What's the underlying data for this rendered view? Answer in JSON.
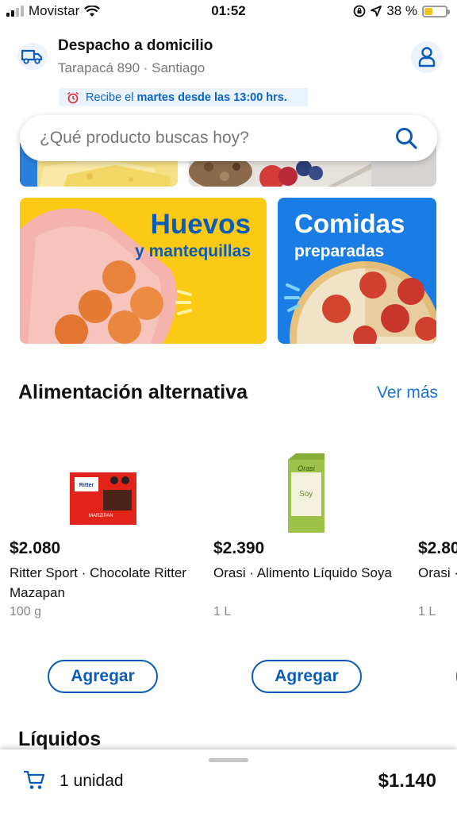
{
  "status_bar": {
    "carrier": "Movistar",
    "time": "01:52",
    "battery_percent": "38 %",
    "battery_level": 0.38
  },
  "header": {
    "delivery_title": "Despacho a domicilio",
    "delivery_address": "Tarapacá 890 · Santiago",
    "notice_prefix": "Recibe el",
    "notice_emphasis": "martes desde las 13:00 hrs."
  },
  "search": {
    "placeholder": "¿Qué producto buscas hoy?"
  },
  "banners": {
    "eggs": {
      "title": "Huevos",
      "subtitle": "y mantequillas"
    },
    "food": {
      "title": "Comidas",
      "subtitle": "preparadas"
    }
  },
  "section": {
    "title": "Alimentación alternativa",
    "see_more": "Ver más"
  },
  "products": [
    {
      "price": "$2.080",
      "name": "Ritter Sport · Chocolate Ritter Mazapan",
      "size": "100 g",
      "add_label": "Agregar",
      "image_text": "MARZIPAN"
    },
    {
      "price": "$2.390",
      "name": "Orasi · Alimento Líquido Soya",
      "size": "1 L",
      "add_label": "Agregar",
      "image_text": "Soy"
    },
    {
      "price": "$2.80",
      "name": "Orasi · Alimen",
      "size": "1 L"
    }
  ],
  "next_section": {
    "title": "Líquidos"
  },
  "cart": {
    "units": "1 unidad",
    "total": "$1.140"
  },
  "colors": {
    "brand_blue": "#0b5cb8",
    "link_blue": "#1a73d9",
    "banner_yellow": "#fcc914",
    "banner_blue": "#1a7de6"
  },
  "icons": [
    "truck-icon",
    "user-icon",
    "alarm-clock-icon",
    "search-icon",
    "cart-icon",
    "wifi-icon",
    "location-arrow-icon",
    "lock-rotation-icon"
  ]
}
